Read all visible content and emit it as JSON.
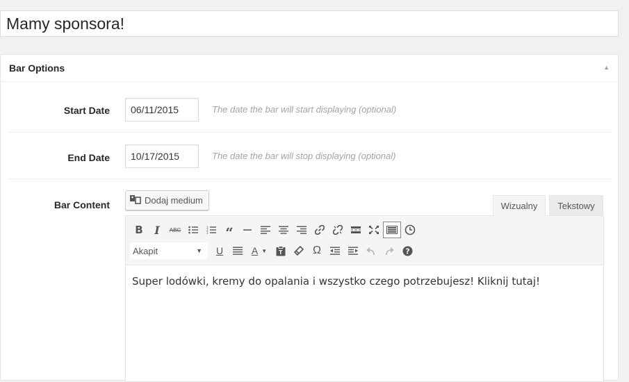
{
  "post_title": "Mamy sponsora!",
  "metabox": {
    "title": "Bar Options",
    "toggle_icon": "arrow-up-icon",
    "start_date": {
      "label": "Start Date",
      "value": "06/11/2015",
      "description": "The date the bar will start displaying (optional)"
    },
    "end_date": {
      "label": "End Date",
      "value": "10/17/2015",
      "description": "The date the bar will stop displaying (optional)"
    },
    "bar_content": {
      "label": "Bar Content",
      "add_media_label": "Dodaj medium",
      "tabs": {
        "visual": "Wizualny",
        "text": "Tekstowy"
      },
      "format_select": "Akapit",
      "content": "Super lodówki, kremy do opalania i wszystko czego potrzebujesz! Kliknij tutaj!"
    }
  },
  "toolbar_row1": [
    "bold-icon",
    "italic-icon",
    "strikethrough-icon",
    "bullet-list-icon",
    "numbered-list-icon",
    "blockquote-icon",
    "horizontal-line-icon",
    "align-left-icon",
    "align-center-icon",
    "align-right-icon",
    "link-icon",
    "unlink-icon",
    "read-more-icon",
    "fullscreen-icon",
    "toolbar-toggle-icon",
    "clock-icon"
  ],
  "toolbar_row2": [
    "format-select",
    "underline-icon",
    "justify-icon",
    "text-color-icon",
    "paste-text-icon",
    "clear-formatting-icon",
    "special-character-icon",
    "outdent-icon",
    "indent-icon",
    "undo-icon",
    "redo-icon",
    "help-icon"
  ]
}
